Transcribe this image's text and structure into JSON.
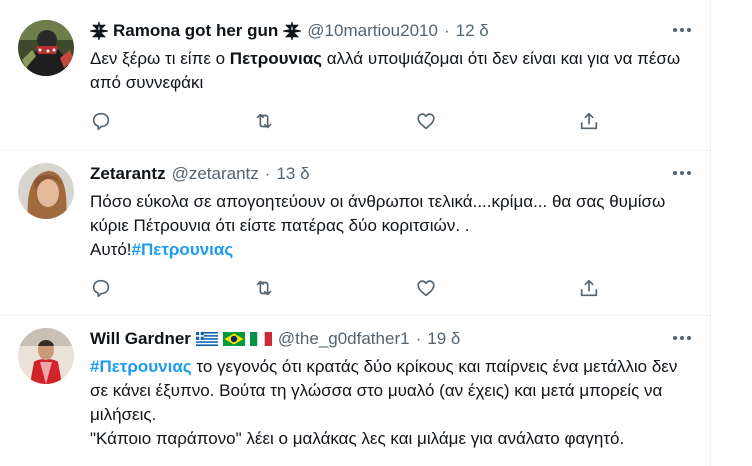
{
  "tweets": [
    {
      "name_prefix_icon": "sparkle-icon",
      "name": "Ramona got her gun",
      "name_suffix_icon": "sparkle-icon",
      "handle": "@10martiou2010",
      "dot": "·",
      "time": "12 δ",
      "text_parts": [
        "Δεν ξέρω τι είπε ο ",
        "Πετρουνιας",
        " αλλά υποψιάζομαι ότι δεν είναι και για να πέσω από συννεφάκι"
      ]
    },
    {
      "name": "Zetarantz",
      "handle": "@zetarantz",
      "dot": "·",
      "time": "13 δ",
      "line1": "Πόσο εύκολα σε απογοητεύουν οι άνθρωποι τελικά....κρίμα... θα σας θυμίσω κύριε Πέτρουνια ότι είστε πατέρας δύο κοριτσιών. .",
      "line2_prefix": "Αυτό!",
      "hashtag": "#Πετρουνιας"
    },
    {
      "name": "Will Gardner",
      "flags": [
        "greece-flag-icon",
        "brazil-flag-icon",
        "italy-flag-icon"
      ],
      "handle": "@the_g0dfather1",
      "dot": "·",
      "time": "19 δ",
      "hashtag": "#Πετρουνιας",
      "line1_rest": " το γεγονός ότι κρατάς δύο κρίκους και παίρνεις ένα μετάλλιο δεν σε κάνει έξυπνο. Βούτα τη γλώσσα στο μυαλό (αν έχεις) και μετά μπορείς να μιλήσεις.",
      "line2": "\"Κάποιο παράπονο\" λέει ο μαλάκας λες και μιλάμε για ανάλατο φαγητό."
    }
  ],
  "colors": {
    "text": "#0f1419",
    "muted": "#536471",
    "link": "#1d9bf0",
    "border": "#eff3f4"
  }
}
